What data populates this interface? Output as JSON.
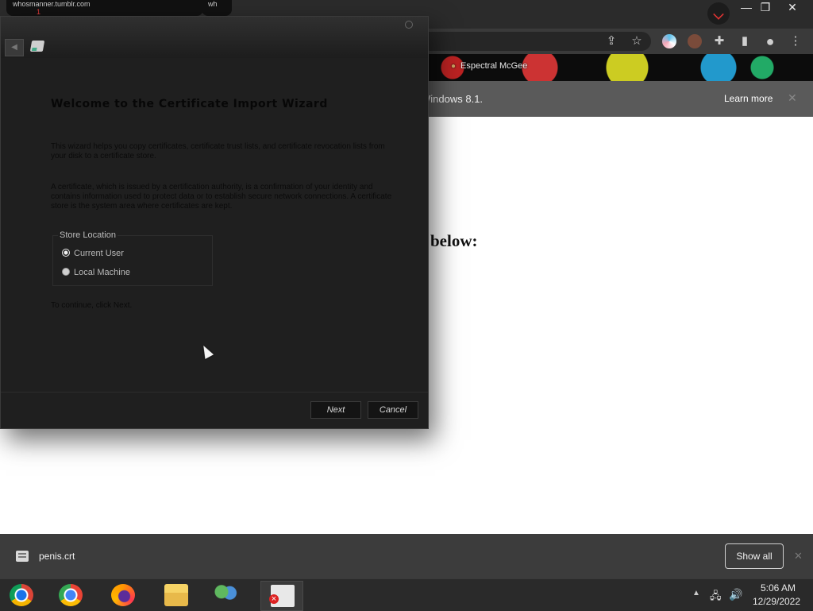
{
  "browser": {
    "tab_thumbnails": [
      {
        "label": "whosmanner.tumblr.com",
        "num": "1"
      },
      {
        "label": "wh",
        "num": ""
      }
    ],
    "window_controls": {
      "minimize": "—",
      "restore": "❐",
      "close": "✕"
    },
    "toolbar_icons": [
      "share-icon",
      "star-icon",
      "extension-icon",
      "sidepanel-icon",
      "profile-icon",
      "menu-icon"
    ],
    "bookmark_label": "Espectral McGee",
    "infobar": {
      "text": "Windows 8.1.",
      "learn_more": "Learn more",
      "close": "✕"
    },
    "page_heading": "below:",
    "download": {
      "filename": "penis.crt",
      "show_all": "Show all",
      "close": "✕"
    }
  },
  "wizard": {
    "title": "Welcome to the Certificate Import Wizard",
    "paragraph1": "This wizard helps you copy certificates, certificate trust lists, and certificate revocation lists from your disk to a certificate store.",
    "paragraph2": "A certificate, which is issued by a certification authority, is a confirmation of your identity and contains information used to protect data or to establish secure network connections. A certificate store is the system area where certificates are kept.",
    "store_location": {
      "legend": "Store Location",
      "options": [
        {
          "label": "Current User",
          "selected": true
        },
        {
          "label": "Local Machine",
          "selected": false
        }
      ]
    },
    "continue_text": "To continue, click Next.",
    "buttons": {
      "next": "Next",
      "cancel": "Cancel"
    }
  },
  "taskbar": {
    "apps": [
      "chrome-beta",
      "chrome",
      "firefox",
      "file-explorer",
      "messenger",
      "certificate-manager"
    ],
    "tray": {
      "chevron": "▲",
      "network": "🖧",
      "volume": "🔊"
    },
    "clock": {
      "time": "5:06 AM",
      "date": "12/29/2022"
    }
  }
}
